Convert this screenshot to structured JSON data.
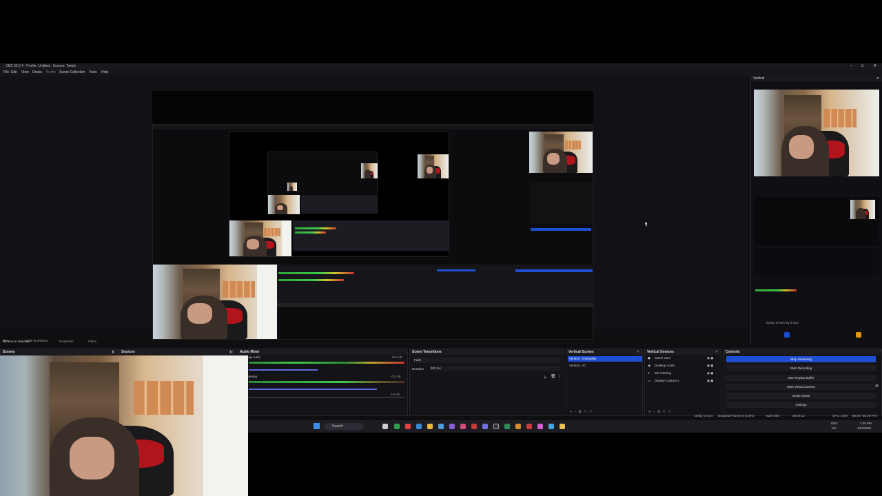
{
  "window": {
    "title": "OBS 32.0.4 - Profile: Untitled - Scenes: Twitch",
    "menu": [
      "File",
      "Edit",
      "View",
      "Docks",
      "Profile",
      "Scene Collection",
      "Tools",
      "Help"
    ],
    "controls": [
      "–",
      "□",
      "✕"
    ]
  },
  "status": {
    "zoom": "85%",
    "scale_mode": "Scale to Window",
    "selection": "No source selected",
    "properties": "Properties",
    "filters": "Filters"
  },
  "vertical": {
    "title": "Vertical",
    "banner": "Nexus is here try it now"
  },
  "docks": {
    "scenes": {
      "title": "Scenes"
    },
    "sources": {
      "title": "Sources"
    },
    "audio_mixer": {
      "title": "Audio Mixer",
      "channels": [
        {
          "name": "Desktop Audio",
          "db": "-21.0 dB"
        },
        {
          "name": "Mic Gaming",
          "db": "-0.0 dB"
        },
        {
          "name": "",
          "db": "0.0 dB"
        }
      ]
    },
    "scene_transitions": {
      "title": "Scene Transitions",
      "transition": "Fade",
      "duration_label": "Duration",
      "duration_value": "300 ms"
    },
    "vertical_scenes": {
      "title": "Vertical Scenes",
      "items": [
        "Vertical - Gameplay",
        "Vertical - JC"
      ],
      "selected": 0
    },
    "vertical_sources": {
      "title": "Vertical Sources",
      "items": [
        {
          "icon": "camera-icon",
          "label": "Game Cam"
        },
        {
          "icon": "speaker-icon",
          "label": "Desktop Audio"
        },
        {
          "icon": "microphone-icon",
          "label": "Mic Gaming"
        },
        {
          "icon": "monitor-icon",
          "label": "Display Capture 2"
        }
      ]
    },
    "controls": {
      "title": "Controls",
      "buttons": [
        "Stop Streaming",
        "Start Recording",
        "Start Replay Buffer",
        "Start Virtual Camera",
        "Studio Mode",
        "Settings"
      ]
    }
  },
  "stats": {
    "delay": "Delay (2 sec)",
    "dropped": "Dropped Frames 0 (0.0%)",
    "bitrate": "6229 kb/s",
    "timer": "00:00:13",
    "cpu": "CPU: 2.5%",
    "fps": "60.00 / 60.00 FPS"
  },
  "taskbar": {
    "search": "Search",
    "lang": "ENG",
    "region": "US",
    "time": "3:38 PM",
    "date": "4/24/2026"
  },
  "colors": {
    "accent": "#1f4fd1",
    "panel": "#141418",
    "meter_green": "#3fc84a",
    "meter_yellow": "#d4c12b",
    "meter_red": "#c83333"
  }
}
